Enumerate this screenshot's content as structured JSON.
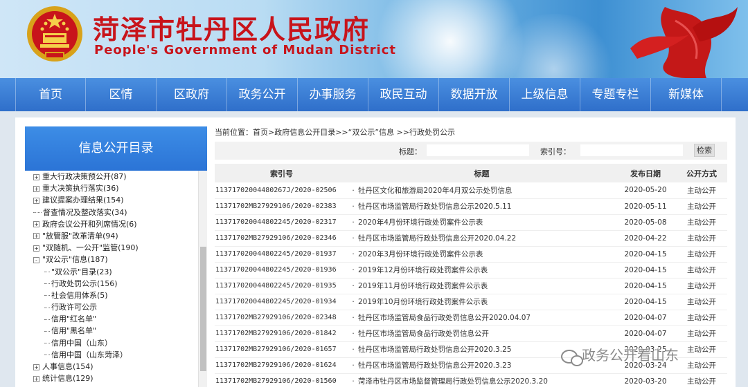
{
  "header": {
    "title": "菏泽市牡丹区人民政府",
    "subtitle": "People's Government of Mudan District"
  },
  "nav": [
    "首页",
    "区情",
    "区政府",
    "政务公开",
    "办事服务",
    "政民互动",
    "数据开放",
    "上级信息",
    "专题专栏",
    "新媒体"
  ],
  "sidebar": {
    "title": "信息公开目录",
    "items": [
      {
        "label": "重大行政决策预公开(87)",
        "level": 0,
        "toggle": "+"
      },
      {
        "label": "重大决策执行落实(36)",
        "level": 0,
        "toggle": "+"
      },
      {
        "label": "建议提案办理结果(154)",
        "level": 0,
        "toggle": "+"
      },
      {
        "label": "督查情况及整改落实(34)",
        "level": 0,
        "toggle": ""
      },
      {
        "label": "政府会议公开和列席情况(6)",
        "level": 0,
        "toggle": "+"
      },
      {
        "label": "\"放管服\"改革清单(94)",
        "level": 0,
        "toggle": "+"
      },
      {
        "label": "\"双随机、一公开\"监管(190)",
        "level": 0,
        "toggle": "+"
      },
      {
        "label": "\"双公示\"信息(187)",
        "level": 0,
        "toggle": "-"
      },
      {
        "label": "\"双公示\"目录(23)",
        "level": 1,
        "toggle": ""
      },
      {
        "label": "行政处罚公示(156)",
        "level": 1,
        "toggle": ""
      },
      {
        "label": "社会信用体系(5)",
        "level": 1,
        "toggle": ""
      },
      {
        "label": "行政许可公示",
        "level": 1,
        "toggle": ""
      },
      {
        "label": "信用\"红名单\"",
        "level": 1,
        "toggle": ""
      },
      {
        "label": "信用\"黑名单\"",
        "level": 1,
        "toggle": ""
      },
      {
        "label": "信用中国（山东）",
        "level": 1,
        "toggle": ""
      },
      {
        "label": "信用中国（山东菏泽）",
        "level": 1,
        "toggle": ""
      },
      {
        "label": "人事信息(154)",
        "level": 0,
        "toggle": "+"
      },
      {
        "label": "统计信息(129)",
        "level": 0,
        "toggle": "+"
      }
    ]
  },
  "breadcrumb": "当前位置：首页>政府信息公开目录>>“双公示”信息 >>行政处罚公示",
  "search": {
    "title_label": "标题：",
    "index_label": "索引号：",
    "button": "检索"
  },
  "table": {
    "headers": [
      "索引号",
      "标题",
      "发布日期",
      "公开方式"
    ],
    "rows": [
      {
        "idx": "11371702004480267J/2020-02506",
        "title": "牡丹区文化和旅游局2020年4月双公示处罚信息",
        "date": "2020-05-20",
        "mode": "主动公开"
      },
      {
        "idx": "11371702MB27929106/2020-02383",
        "title": "牡丹区市场监管局行政处罚信息公示2020.5.11",
        "date": "2020-05-11",
        "mode": "主动公开"
      },
      {
        "idx": "113717020044802245/2020-02317",
        "title": "2020年4月份环境行政处罚案件公示表",
        "date": "2020-05-08",
        "mode": "主动公开"
      },
      {
        "idx": "11371702MB27929106/2020-02346",
        "title": "牡丹区市场监管局行政处罚信息公开2020.04.22",
        "date": "2020-04-22",
        "mode": "主动公开"
      },
      {
        "idx": "113717020044802245/2020-01937",
        "title": "2020年3月份环境行政处罚案件公示表",
        "date": "2020-04-15",
        "mode": "主动公开"
      },
      {
        "idx": "113717020044802245/2020-01936",
        "title": "2019年12月份环境行政处罚案件公示表",
        "date": "2020-04-15",
        "mode": "主动公开"
      },
      {
        "idx": "113717020044802245/2020-01935",
        "title": "2019年11月份环境行政处罚案件公示表",
        "date": "2020-04-15",
        "mode": "主动公开"
      },
      {
        "idx": "113717020044802245/2020-01934",
        "title": "2019年10月份环境行政处罚案件公示表",
        "date": "2020-04-15",
        "mode": "主动公开"
      },
      {
        "idx": "11371702MB27929106/2020-02348",
        "title": "牡丹区市场监管局食品行政处罚信息公开2020.04.07",
        "date": "2020-04-07",
        "mode": "主动公开"
      },
      {
        "idx": "11371702MB27929106/2020-01842",
        "title": "牡丹区市场监管局食品行政处罚信息公开",
        "date": "2020-04-07",
        "mode": "主动公开"
      },
      {
        "idx": "11371702MB27929106/2020-01657",
        "title": "牡丹区市场监管局行政处罚信息公开2020.3.25",
        "date": "2020-03-25",
        "mode": "主动公开"
      },
      {
        "idx": "11371702MB27929106/2020-01624",
        "title": "牡丹区市场监管局行政处罚信息公开2020.3.23",
        "date": "2020-03-24",
        "mode": "主动公开"
      },
      {
        "idx": "11371702MB27929106/2020-01560",
        "title": "菏泽市牡丹区市场监督管理局行政处罚信息公示2020.3.20",
        "date": "2020-03-20",
        "mode": "主动公开"
      }
    ]
  },
  "watermark": "政务公开看山东"
}
